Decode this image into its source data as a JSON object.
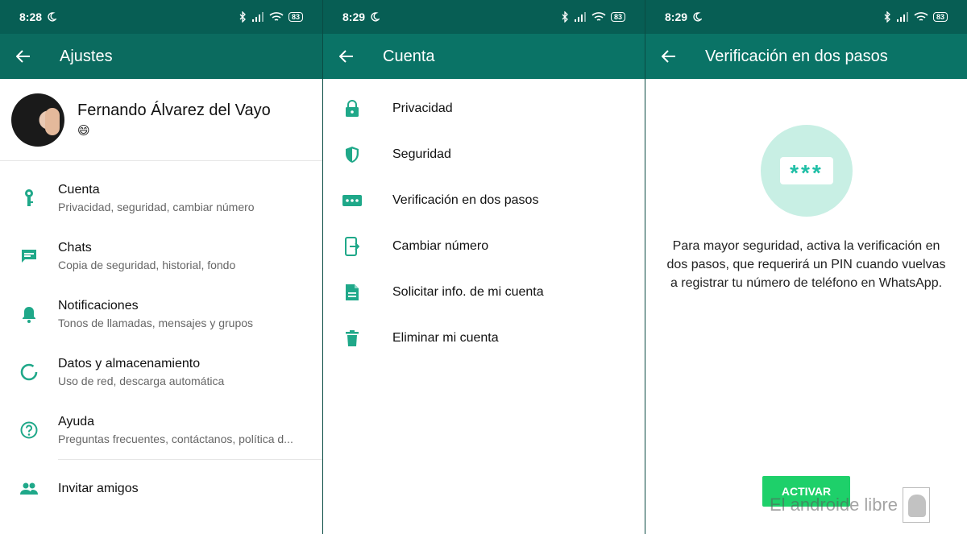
{
  "colors": {
    "accent": "#1fa889",
    "statusbar": "#075e54",
    "appbar": "#0a7366",
    "button": "#1ed06a"
  },
  "panels": [
    {
      "status": {
        "time": "8:28",
        "battery": "83"
      },
      "title": "Ajustes",
      "profile": {
        "name": "Fernando Álvarez del Vayo",
        "status": "😄"
      },
      "items": [
        {
          "icon": "key-icon",
          "title": "Cuenta",
          "subtitle": "Privacidad, seguridad, cambiar número"
        },
        {
          "icon": "chat-icon",
          "title": "Chats",
          "subtitle": "Copia de seguridad, historial, fondo"
        },
        {
          "icon": "bell-icon",
          "title": "Notificaciones",
          "subtitle": "Tonos de llamadas, mensajes y grupos"
        },
        {
          "icon": "data-usage-icon",
          "title": "Datos y almacenamiento",
          "subtitle": "Uso de red, descarga automática"
        },
        {
          "icon": "help-icon",
          "title": "Ayuda",
          "subtitle": "Preguntas frecuentes, contáctanos, política d..."
        }
      ],
      "invite": {
        "icon": "people-icon",
        "title": "Invitar amigos"
      }
    },
    {
      "status": {
        "time": "8:29",
        "battery": "83"
      },
      "title": "Cuenta",
      "items": [
        {
          "icon": "lock-icon",
          "label": "Privacidad"
        },
        {
          "icon": "shield-icon",
          "label": "Seguridad"
        },
        {
          "icon": "dots-icon",
          "label": "Verificación en dos pasos"
        },
        {
          "icon": "change-number-icon",
          "label": "Cambiar número"
        },
        {
          "icon": "document-icon",
          "label": "Solicitar info. de mi cuenta"
        },
        {
          "icon": "trash-icon",
          "label": "Eliminar mi cuenta"
        }
      ]
    },
    {
      "status": {
        "time": "8:29",
        "battery": "83"
      },
      "title": "Verificación en dos pasos",
      "pin_glyph": "***",
      "description": "Para mayor seguridad, activa la verificación en dos pasos, que requerirá un PIN cuando vuelvas a registrar tu número de teléfono en WhatsApp.",
      "button": "ACTIVAR",
      "watermark": "El androide libre"
    }
  ]
}
